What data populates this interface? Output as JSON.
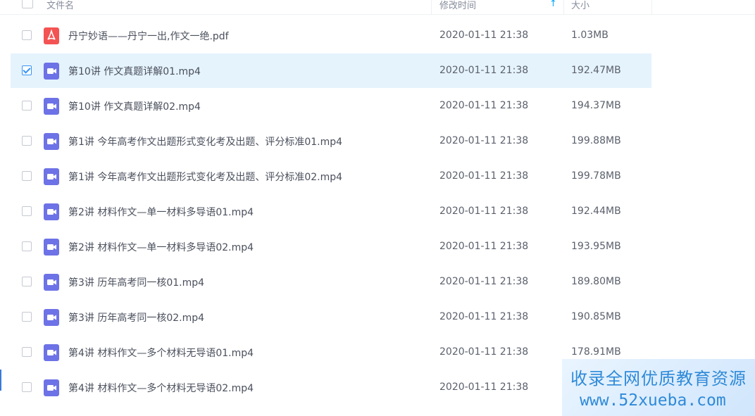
{
  "header": {
    "col_name": "文件名",
    "col_modified": "修改时间",
    "col_size": "大小",
    "sort_icon": "↑"
  },
  "rows": [
    {
      "name": "丹宁妙语——丹宁一出,作文一绝.pdf",
      "date": "2020-01-11 21:38",
      "size": "1.03MB",
      "type": "pdf",
      "checked": false
    },
    {
      "name": "第10讲 作文真题详解01.mp4",
      "date": "2020-01-11 21:38",
      "size": "192.47MB",
      "type": "video",
      "checked": true
    },
    {
      "name": "第10讲 作文真题详解02.mp4",
      "date": "2020-01-11 21:38",
      "size": "194.37MB",
      "type": "video",
      "checked": false
    },
    {
      "name": "第1讲 今年高考作文出题形式变化考及出题、评分标准01.mp4",
      "date": "2020-01-11 21:38",
      "size": "199.88MB",
      "type": "video",
      "checked": false
    },
    {
      "name": "第1讲 今年高考作文出题形式变化考及出题、评分标准02.mp4",
      "date": "2020-01-11 21:38",
      "size": "199.78MB",
      "type": "video",
      "checked": false
    },
    {
      "name": "第2讲 材料作文—单一材料多导语01.mp4",
      "date": "2020-01-11 21:38",
      "size": "192.44MB",
      "type": "video",
      "checked": false
    },
    {
      "name": "第2讲 材料作文—单一材料多导语02.mp4",
      "date": "2020-01-11 21:38",
      "size": "193.95MB",
      "type": "video",
      "checked": false
    },
    {
      "name": "第3讲 历年高考同一核01.mp4",
      "date": "2020-01-11 21:38",
      "size": "189.80MB",
      "type": "video",
      "checked": false
    },
    {
      "name": "第3讲 历年高考同一核02.mp4",
      "date": "2020-01-11 21:38",
      "size": "190.85MB",
      "type": "video",
      "checked": false
    },
    {
      "name": "第4讲 材料作文—多个材料无导语01.mp4",
      "date": "2020-01-11 21:38",
      "size": "178.91MB",
      "type": "video",
      "checked": false
    },
    {
      "name": "第4讲 材料作文—多个材料无导语02.mp4",
      "date": "2020-01-11 21:38",
      "size": "",
      "type": "video",
      "checked": false
    }
  ],
  "watermark": {
    "line1": "收录全网优质教育资源",
    "line2": "www.52xueba.com"
  }
}
